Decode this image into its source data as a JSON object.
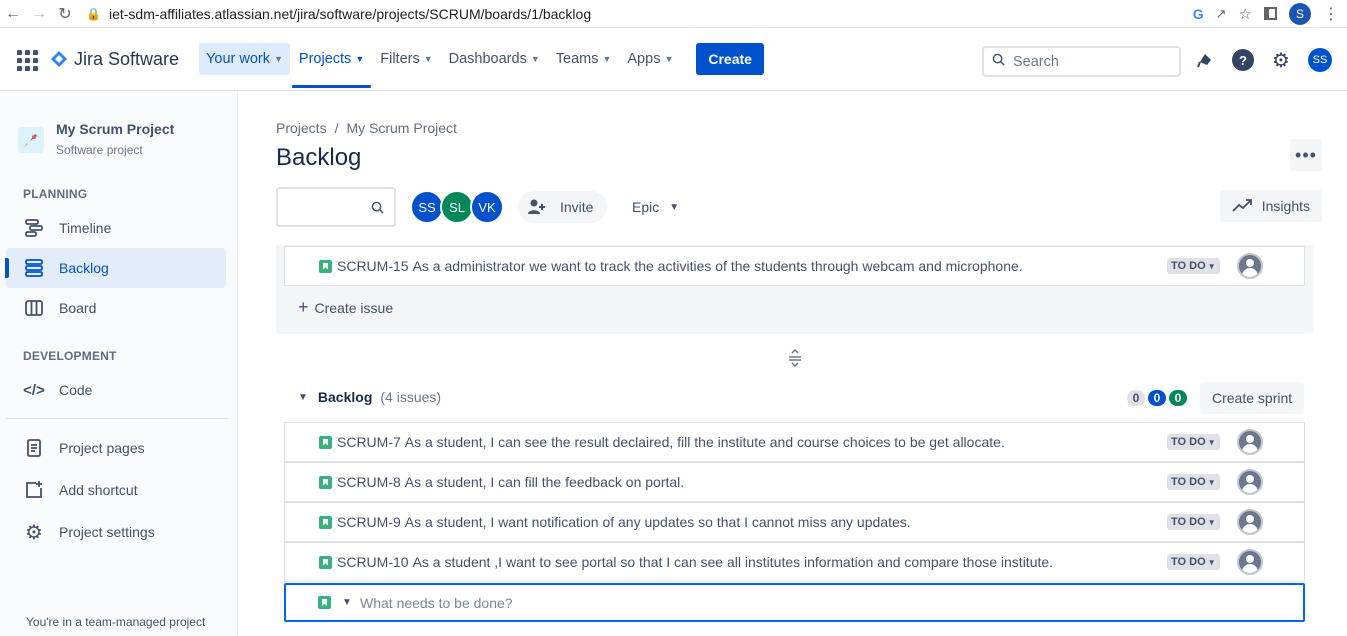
{
  "browser": {
    "url": "iet-sdm-affiliates.atlassian.net/jira/software/projects/SCRUM/boards/1/backlog",
    "profile_initial": "S"
  },
  "topnav": {
    "brand": "Jira Software",
    "items": [
      {
        "label": "Your work"
      },
      {
        "label": "Projects"
      },
      {
        "label": "Filters"
      },
      {
        "label": "Dashboards"
      },
      {
        "label": "Teams"
      },
      {
        "label": "Apps"
      }
    ],
    "create_label": "Create",
    "search_placeholder": "Search",
    "user_initials": "SS"
  },
  "sidebar": {
    "project_name": "My Scrum Project",
    "project_type": "Software project",
    "planning_label": "PLANNING",
    "development_label": "DEVELOPMENT",
    "items": {
      "timeline": "Timeline",
      "backlog": "Backlog",
      "board": "Board",
      "code": "Code",
      "project_pages": "Project pages",
      "add_shortcut": "Add shortcut",
      "project_settings": "Project settings"
    },
    "team_note": "You're in a team-managed project"
  },
  "main": {
    "breadcrumb": [
      "Projects",
      "My Scrum Project"
    ],
    "title": "Backlog",
    "avatars": [
      {
        "initials": "SS",
        "color": "#0052cc"
      },
      {
        "initials": "SL",
        "color": "#00875a"
      },
      {
        "initials": "VK",
        "color": "#0052cc"
      }
    ],
    "invite_label": "Invite",
    "epic_label": "Epic",
    "insights_label": "Insights",
    "sprint_issue": {
      "key": "SCRUM-15",
      "summary": "As a administrator we want to track the activities of the students through webcam and microphone.",
      "status": "TO DO"
    },
    "create_issue_label": "Create issue",
    "backlog": {
      "title": "Backlog",
      "count": "(4 issues)",
      "badges": [
        "0",
        "0",
        "0"
      ],
      "create_sprint_label": "Create sprint",
      "issues": [
        {
          "key": "SCRUM-7",
          "summary": "As a student, I can see the result declaired, fill the institute and course choices to be get allocate.",
          "status": "TO DO"
        },
        {
          "key": "SCRUM-8",
          "summary": "As a student, I can fill the feedback on portal.",
          "status": "TO DO"
        },
        {
          "key": "SCRUM-9",
          "summary": "As a student, I want notification of any updates so that I cannot miss any updates.",
          "status": "TO DO"
        },
        {
          "key": "SCRUM-10",
          "summary": "As a student ,I want to see portal so that I can see all institutes information and compare those institute.",
          "status": "TO DO"
        }
      ],
      "new_issue_placeholder": "What needs to be done?"
    }
  }
}
